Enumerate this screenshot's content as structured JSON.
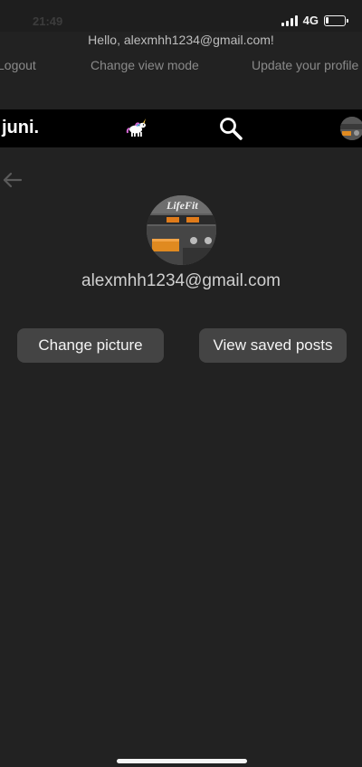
{
  "status": {
    "time": "21:49",
    "network": "4G"
  },
  "header": {
    "greeting": "Hello, alexmhh1234@gmail.com!",
    "menu": {
      "logout": "Logout",
      "change_view_mode": "Change view mode",
      "update_profile": "Update your profile"
    }
  },
  "navbar": {
    "brand": "juni.",
    "icons": [
      "unicorn-icon",
      "search-icon",
      "avatar"
    ]
  },
  "profile": {
    "email": "alexmhh1234@gmail.com",
    "change_picture_label": "Change picture",
    "view_saved_posts_label": "View saved posts"
  },
  "colors": {
    "background": "#222222",
    "navbar": "#000000",
    "button": "#444444"
  }
}
